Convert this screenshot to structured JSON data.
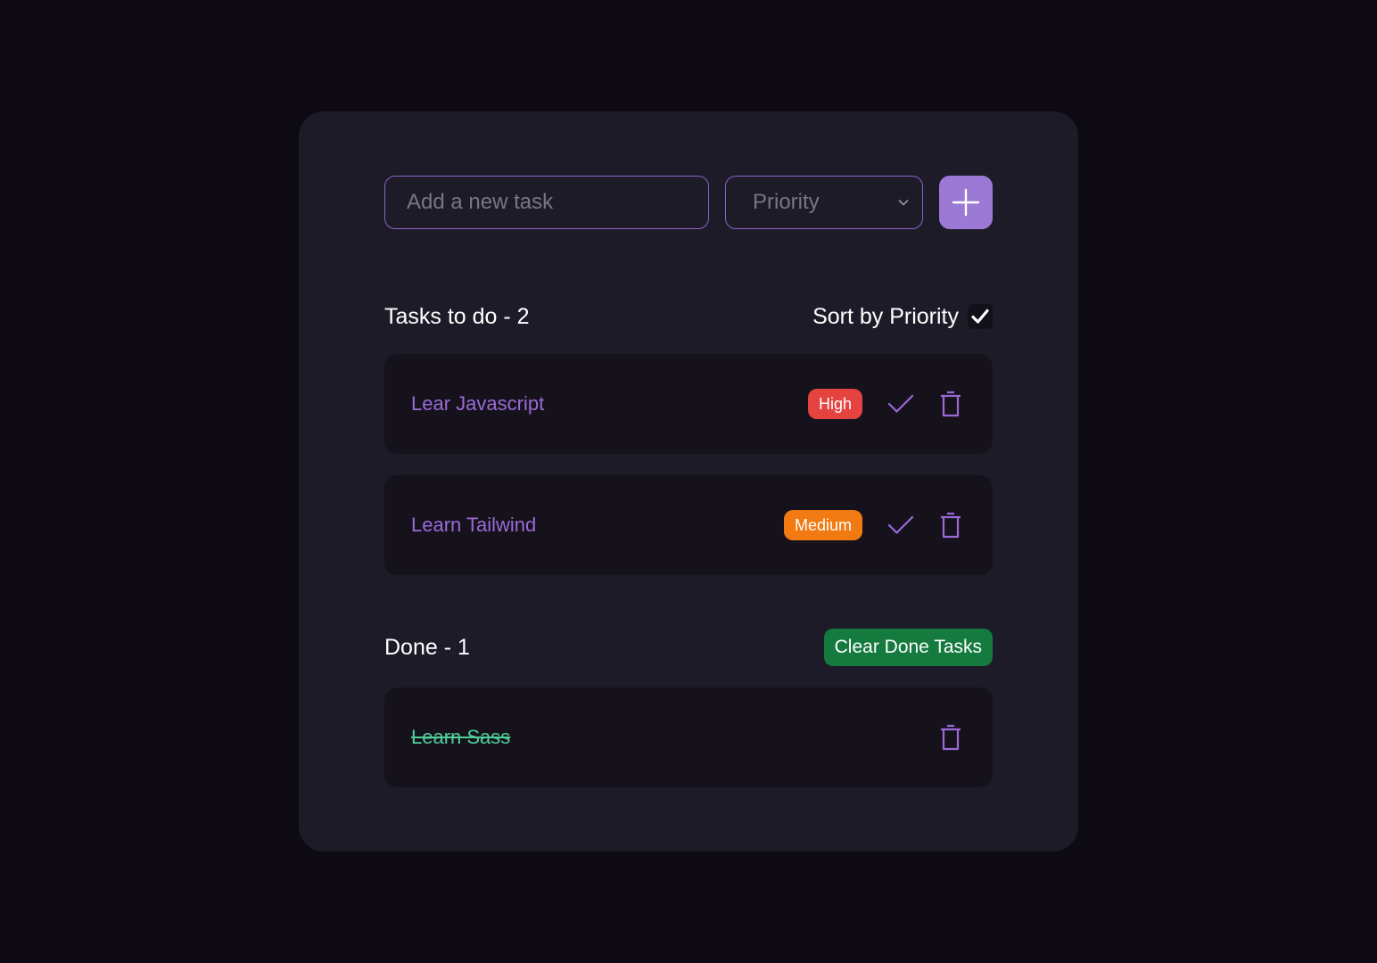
{
  "input": {
    "placeholder": "Add a new task"
  },
  "priority_select": {
    "label": "Priority"
  },
  "todo": {
    "heading": "Tasks to do - 2",
    "sort_label": "Sort by Priority",
    "sort_checked": true,
    "tasks": [
      {
        "title": "Lear Javascript",
        "priority": "High",
        "color": "#e5433f"
      },
      {
        "title": "Learn Tailwind",
        "priority": "Medium",
        "color": "#f27a12"
      }
    ]
  },
  "done": {
    "heading": "Done - 1",
    "clear_label": "Clear Done Tasks",
    "tasks": [
      {
        "title": "Learn Sass"
      }
    ]
  },
  "colors": {
    "accent": "#9b79d4",
    "done_text": "#4fcf9a",
    "clear_button": "#157a3e"
  }
}
